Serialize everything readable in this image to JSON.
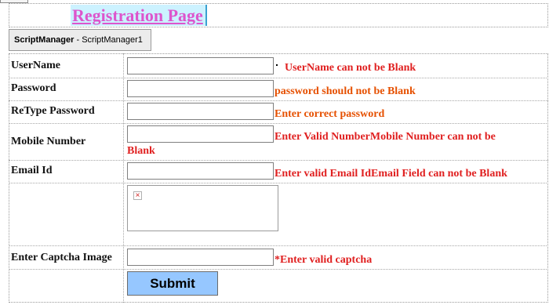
{
  "page": {
    "title": "Registration Page"
  },
  "script_manager": {
    "name": "ScriptManager",
    "id": "ScriptManager1"
  },
  "form": {
    "username": {
      "label": "UserName",
      "value": "",
      "error": "UserName can not be Blank"
    },
    "password": {
      "label": "Password",
      "value": "",
      "error": "password should not be Blank"
    },
    "retype_password": {
      "label": "ReType Password",
      "value": "",
      "error": "Enter correct password"
    },
    "mobile": {
      "label": "Mobile Number",
      "value": "",
      "error_line1": "Enter Valid NumberMobile Number can not be",
      "error_line2": "Blank"
    },
    "email": {
      "label": "Email Id",
      "value": "",
      "error": "Enter valid Email IdEmail Field can not be Blank"
    },
    "captcha": {
      "image_icon": "broken-image-icon",
      "label": "Enter Captcha Image",
      "value": "",
      "error": "*Enter valid captcha"
    },
    "submit_label": "Submit"
  },
  "colors": {
    "title_text": "#dd55cc",
    "title_bg": "#ccf2ff",
    "error_red": "#e02020",
    "error_orange": "#e65000",
    "submit_bg": "#96c7ff"
  }
}
